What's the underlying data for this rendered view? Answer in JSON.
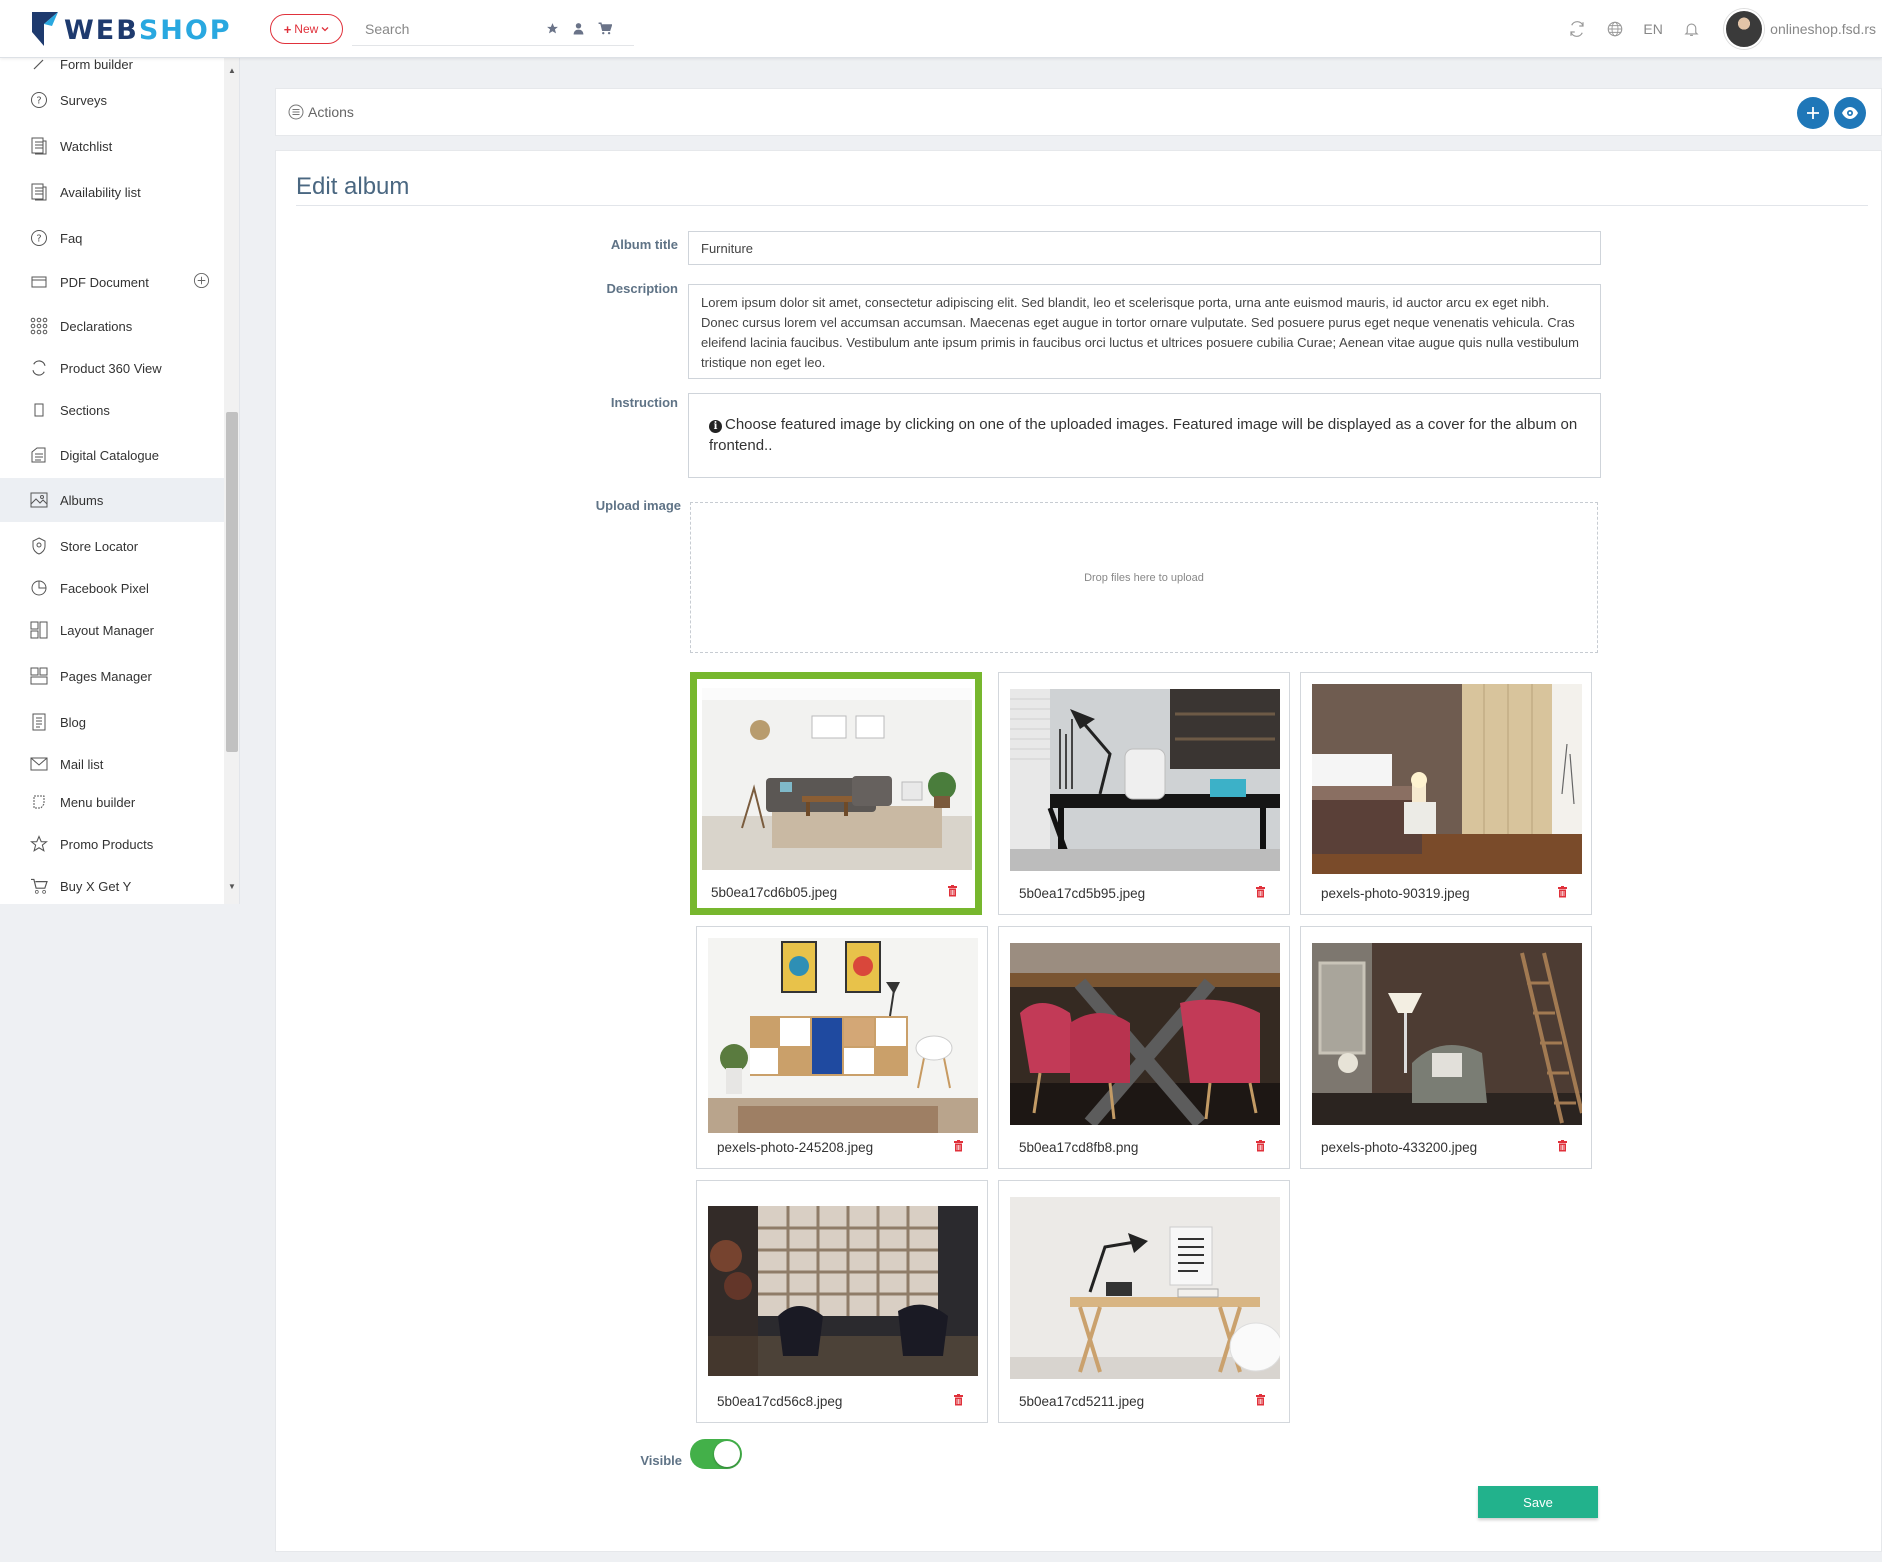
{
  "brand": {
    "part1": "WEB",
    "part2": "SHOP"
  },
  "header": {
    "new_label": "New",
    "search_placeholder": "Search",
    "language": "EN",
    "user": "onlineshop.fsd.rs"
  },
  "sidebar": {
    "cut_item": "Form builder",
    "items": [
      {
        "label": "Surveys",
        "icon": "question-circle-icon"
      },
      {
        "label": "Watchlist",
        "icon": "list-doc-icon"
      },
      {
        "label": "Availability list",
        "icon": "list-doc-icon"
      },
      {
        "label": "Faq",
        "icon": "question-circle-icon"
      },
      {
        "label": "PDF Document",
        "icon": "pdf-icon"
      },
      {
        "label": "Declarations",
        "icon": "grid-dots-icon"
      },
      {
        "label": "Product 360 View",
        "icon": "rotate-icon"
      },
      {
        "label": "Sections",
        "icon": "square-icon"
      },
      {
        "label": "Digital Catalogue",
        "icon": "catalogue-icon"
      },
      {
        "label": "Albums",
        "icon": "image-icon"
      },
      {
        "label": "Store Locator",
        "icon": "shield-icon"
      },
      {
        "label": "Facebook Pixel",
        "icon": "pie-icon"
      },
      {
        "label": "Layout Manager",
        "icon": "layout-icon"
      },
      {
        "label": "Pages Manager",
        "icon": "layout-icon"
      },
      {
        "label": "Blog",
        "icon": "blog-icon"
      },
      {
        "label": "Mail list",
        "icon": "mail-icon"
      },
      {
        "label": "Menu builder",
        "icon": "menu-builder-icon"
      },
      {
        "label": "Promo Products",
        "icon": "star-icon"
      },
      {
        "label": "Buy X Get Y",
        "icon": "cart-icon"
      }
    ],
    "active": "Albums"
  },
  "actions": {
    "label": "Actions"
  },
  "page": {
    "title": "Edit album"
  },
  "form": {
    "album_title_label": "Album title",
    "album_title_value": "Furniture",
    "description_label": "Description",
    "description_value": "Lorem ipsum dolor sit amet, consectetur adipiscing elit. Sed blandit, leo et scelerisque porta, urna ante euismod mauris, id auctor arcu ex eget nibh. Donec cursus lorem vel accumsan accumsan. Maecenas eget augue in tortor ornare vulputate. Sed posuere purus eget neque venenatis vehicula. Cras eleifend lacinia faucibus. Vestibulum ante ipsum primis in faucibus orci luctus et ultrices posuere cubilia Curae; Aenean vitae augue quis nulla vestibulum tristique non eget leo.",
    "instruction_label": "Instruction",
    "instruction_text": "Choose featured image by clicking on one of the uploaded images. Featured image will be displayed as a cover for the album on frontend..",
    "upload_label": "Upload image",
    "dropzone_text": "Drop files here to upload",
    "visible_label": "Visible",
    "visible_value": true,
    "save_label": "Save"
  },
  "images": [
    {
      "filename": "5b0ea17cd6b05.jpeg",
      "featured": true
    },
    {
      "filename": "5b0ea17cd5b95.jpeg",
      "featured": false
    },
    {
      "filename": "pexels-photo-90319.jpeg",
      "featured": false
    },
    {
      "filename": "pexels-photo-245208.jpeg",
      "featured": false
    },
    {
      "filename": "5b0ea17cd8fb8.png",
      "featured": false
    },
    {
      "filename": "pexels-photo-433200.jpeg",
      "featured": false
    },
    {
      "filename": "5b0ea17cd56c8.jpeg",
      "featured": false
    },
    {
      "filename": "5b0ea17cd5211.jpeg",
      "featured": false
    }
  ],
  "colors": {
    "brand_dark": "#1e3a6e",
    "brand_light": "#29a8e0",
    "new_button": "#e0313b",
    "featured_border": "#77b72e",
    "toggle_on": "#43b049",
    "save": "#22b28c",
    "action_circle": "#1f77b8"
  }
}
